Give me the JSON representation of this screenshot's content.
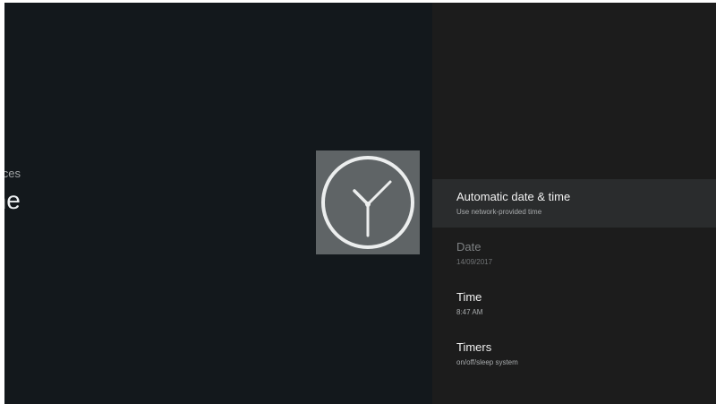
{
  "header": {
    "breadcrumb": "Preferences",
    "title": "Date & Time",
    "icon": "clock-icon"
  },
  "menu": {
    "items": [
      {
        "label": "Automatic date & time",
        "value": "Use network-provided time",
        "state": "focused"
      },
      {
        "label": "Date",
        "value": "14/09/2017",
        "state": "disabled"
      },
      {
        "label": "Time",
        "value": "8:47 AM",
        "state": "normal"
      },
      {
        "label": "Timers",
        "value": "on/off/sleep system",
        "state": "normal"
      }
    ]
  },
  "colors": {
    "background": "#13181c",
    "panel": "#1c1c1c",
    "focus_row": "#2a2c2d",
    "icon_tile": "#5f6466"
  }
}
